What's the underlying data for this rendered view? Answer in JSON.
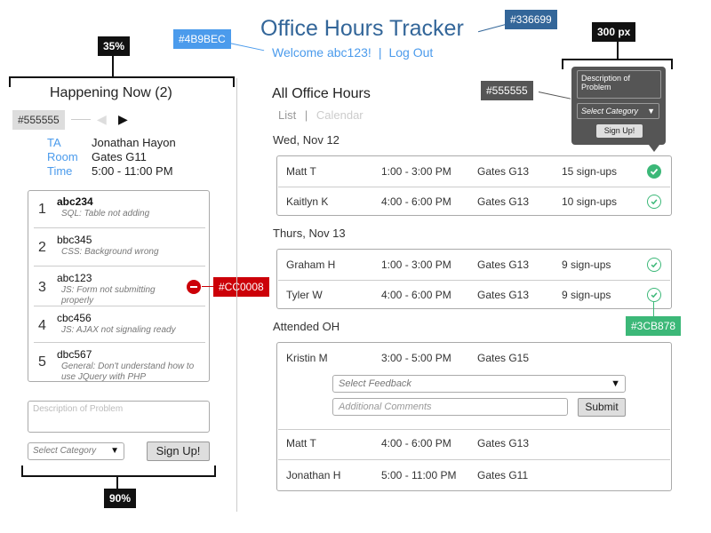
{
  "header": {
    "title": "Office Hours Tracker",
    "welcome": "Welcome abc123!",
    "separator": "|",
    "logout": "Log Out"
  },
  "annotations": {
    "title_color": "#336699",
    "welcome_color": "#4B9BEC",
    "left_width": "35%",
    "popup_width": "300 px",
    "popup_color": "#555555",
    "nav_color": "#555555",
    "remove_color": "#CC0008",
    "check_color": "#3CB878",
    "bottom_width": "90%"
  },
  "happening": {
    "title": "Happening Now (2)",
    "prev_icon": "triangle-left",
    "next_icon": "triangle-right",
    "ta_label": "TA",
    "ta_value": "Jonathan Hayon",
    "room_label": "Room",
    "room_value": "Gates G11",
    "time_label": "Time",
    "time_value": "5:00 - 11:00 PM",
    "queue": [
      {
        "num": "1",
        "user": "abc234",
        "desc": "SQL: Table not adding"
      },
      {
        "num": "2",
        "user": "bbc345",
        "desc": "CSS: Background wrong"
      },
      {
        "num": "3",
        "user": "abc123",
        "desc": "JS: Form not submitting properly"
      },
      {
        "num": "4",
        "user": "cbc456",
        "desc": "JS: AJAX not signaling ready"
      },
      {
        "num": "5",
        "user": "dbc567",
        "desc": "General: Don't understand how to use JQuery with PHP"
      }
    ],
    "desc_placeholder": "Description of Problem",
    "category_placeholder": "Select Category",
    "signup_label": "Sign Up!"
  },
  "all_oh": {
    "title": "All Office Hours",
    "tab_list": "List",
    "tab_sep": "|",
    "tab_calendar": "Calendar",
    "days": [
      {
        "date": "Wed, Nov 12",
        "rows": [
          {
            "name": "Matt T",
            "time": "1:00 - 3:00 PM",
            "room": "Gates G13",
            "signups": "15 sign-ups",
            "checked": true
          },
          {
            "name": "Kaitlyn K",
            "time": "4:00 - 6:00 PM",
            "room": "Gates G13",
            "signups": "10 sign-ups",
            "checked": false
          }
        ]
      },
      {
        "date": "Thurs, Nov 13",
        "rows": [
          {
            "name": "Graham H",
            "time": "1:00 - 3:00 PM",
            "room": "Gates G13",
            "signups": "9 sign-ups",
            "checked": false
          },
          {
            "name": "Tyler W",
            "time": "4:00 - 6:00 PM",
            "room": "Gates G13",
            "signups": "9 sign-ups",
            "checked": false
          }
        ]
      }
    ]
  },
  "popup": {
    "desc_placeholder": "Description of Problem",
    "category_placeholder": "Select Category",
    "signup_label": "Sign Up!"
  },
  "attended": {
    "title": "Attended OH",
    "rows": [
      {
        "name": "Kristin M",
        "time": "3:00 - 5:00 PM",
        "room": "Gates G15"
      },
      {
        "name": "Matt T",
        "time": "4:00 - 6:00 PM",
        "room": "Gates G13"
      },
      {
        "name": "Jonathan H",
        "time": "5:00 - 11:00 PM",
        "room": "Gates G11"
      }
    ],
    "feedback_placeholder": "Select Feedback",
    "comments_placeholder": "Additional Comments",
    "submit_label": "Submit"
  }
}
